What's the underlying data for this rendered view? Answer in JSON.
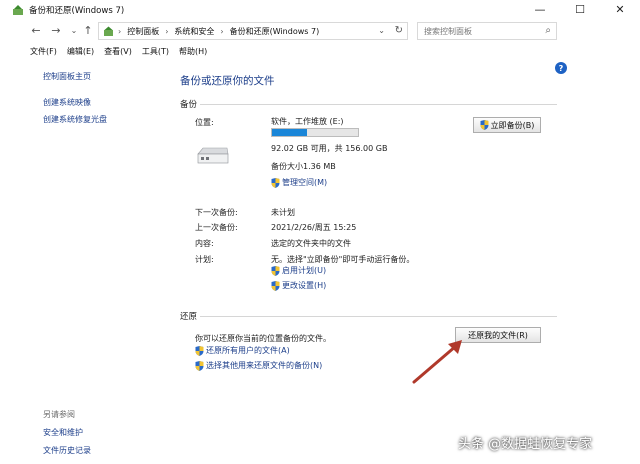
{
  "window": {
    "title": "备份和还原(Windows 7)",
    "minimize_icon": "minimize-icon",
    "maximize_icon": "maximize-icon",
    "close_icon": "close-icon"
  },
  "address": {
    "breadcrumbs": [
      "控制面板",
      "系统和安全",
      "备份和还原(Windows 7)"
    ],
    "search_placeholder": "搜索控制面板"
  },
  "menu": [
    "文件(F)",
    "编辑(E)",
    "查看(V)",
    "工具(T)",
    "帮助(H)"
  ],
  "sidebar": {
    "home": "控制面板主页",
    "create_image": "创建系统映像",
    "create_repair": "创建系统修复光盘",
    "see_also": "另请参阅",
    "security": "安全和维护",
    "file_history": "文件历史记录"
  },
  "main": {
    "title": "备份或还原你的文件",
    "backup": {
      "section": "备份",
      "location_label": "位置:",
      "location_value": "软件，工作堆放 (E:)",
      "space": "92.02 GB 可用，共 156.00 GB",
      "used_fraction": 0.41,
      "size": "备份大小1.36 MB",
      "manage_space": "管理空间(M)",
      "backup_now": "立即备份(B)",
      "next_label": "下一次备份:",
      "next_value": "未计划",
      "last_label": "上一次备份:",
      "last_value": "2021/2/26/周五 15:25",
      "content_label": "内容:",
      "content_value": "选定的文件夹中的文件",
      "schedule_label": "计划:",
      "schedule_value": "无。选择\"立即备份\"即可手动运行备份。",
      "enable_schedule": "启用计划(U)",
      "change_settings": "更改设置(H)"
    },
    "restore": {
      "section": "还原",
      "desc": "你可以还原你当前的位置备份的文件。",
      "restore_all": "还原所有用户的文件(A)",
      "select_other": "选择其他用来还原文件的备份(N)",
      "restore_my_files": "还原我的文件(R)"
    }
  },
  "watermark": "头条 @数据蛙恢复专家",
  "colors": {
    "link": "#1c3e8a",
    "progress": "#1a86d8",
    "arrow": "#b0392b"
  }
}
